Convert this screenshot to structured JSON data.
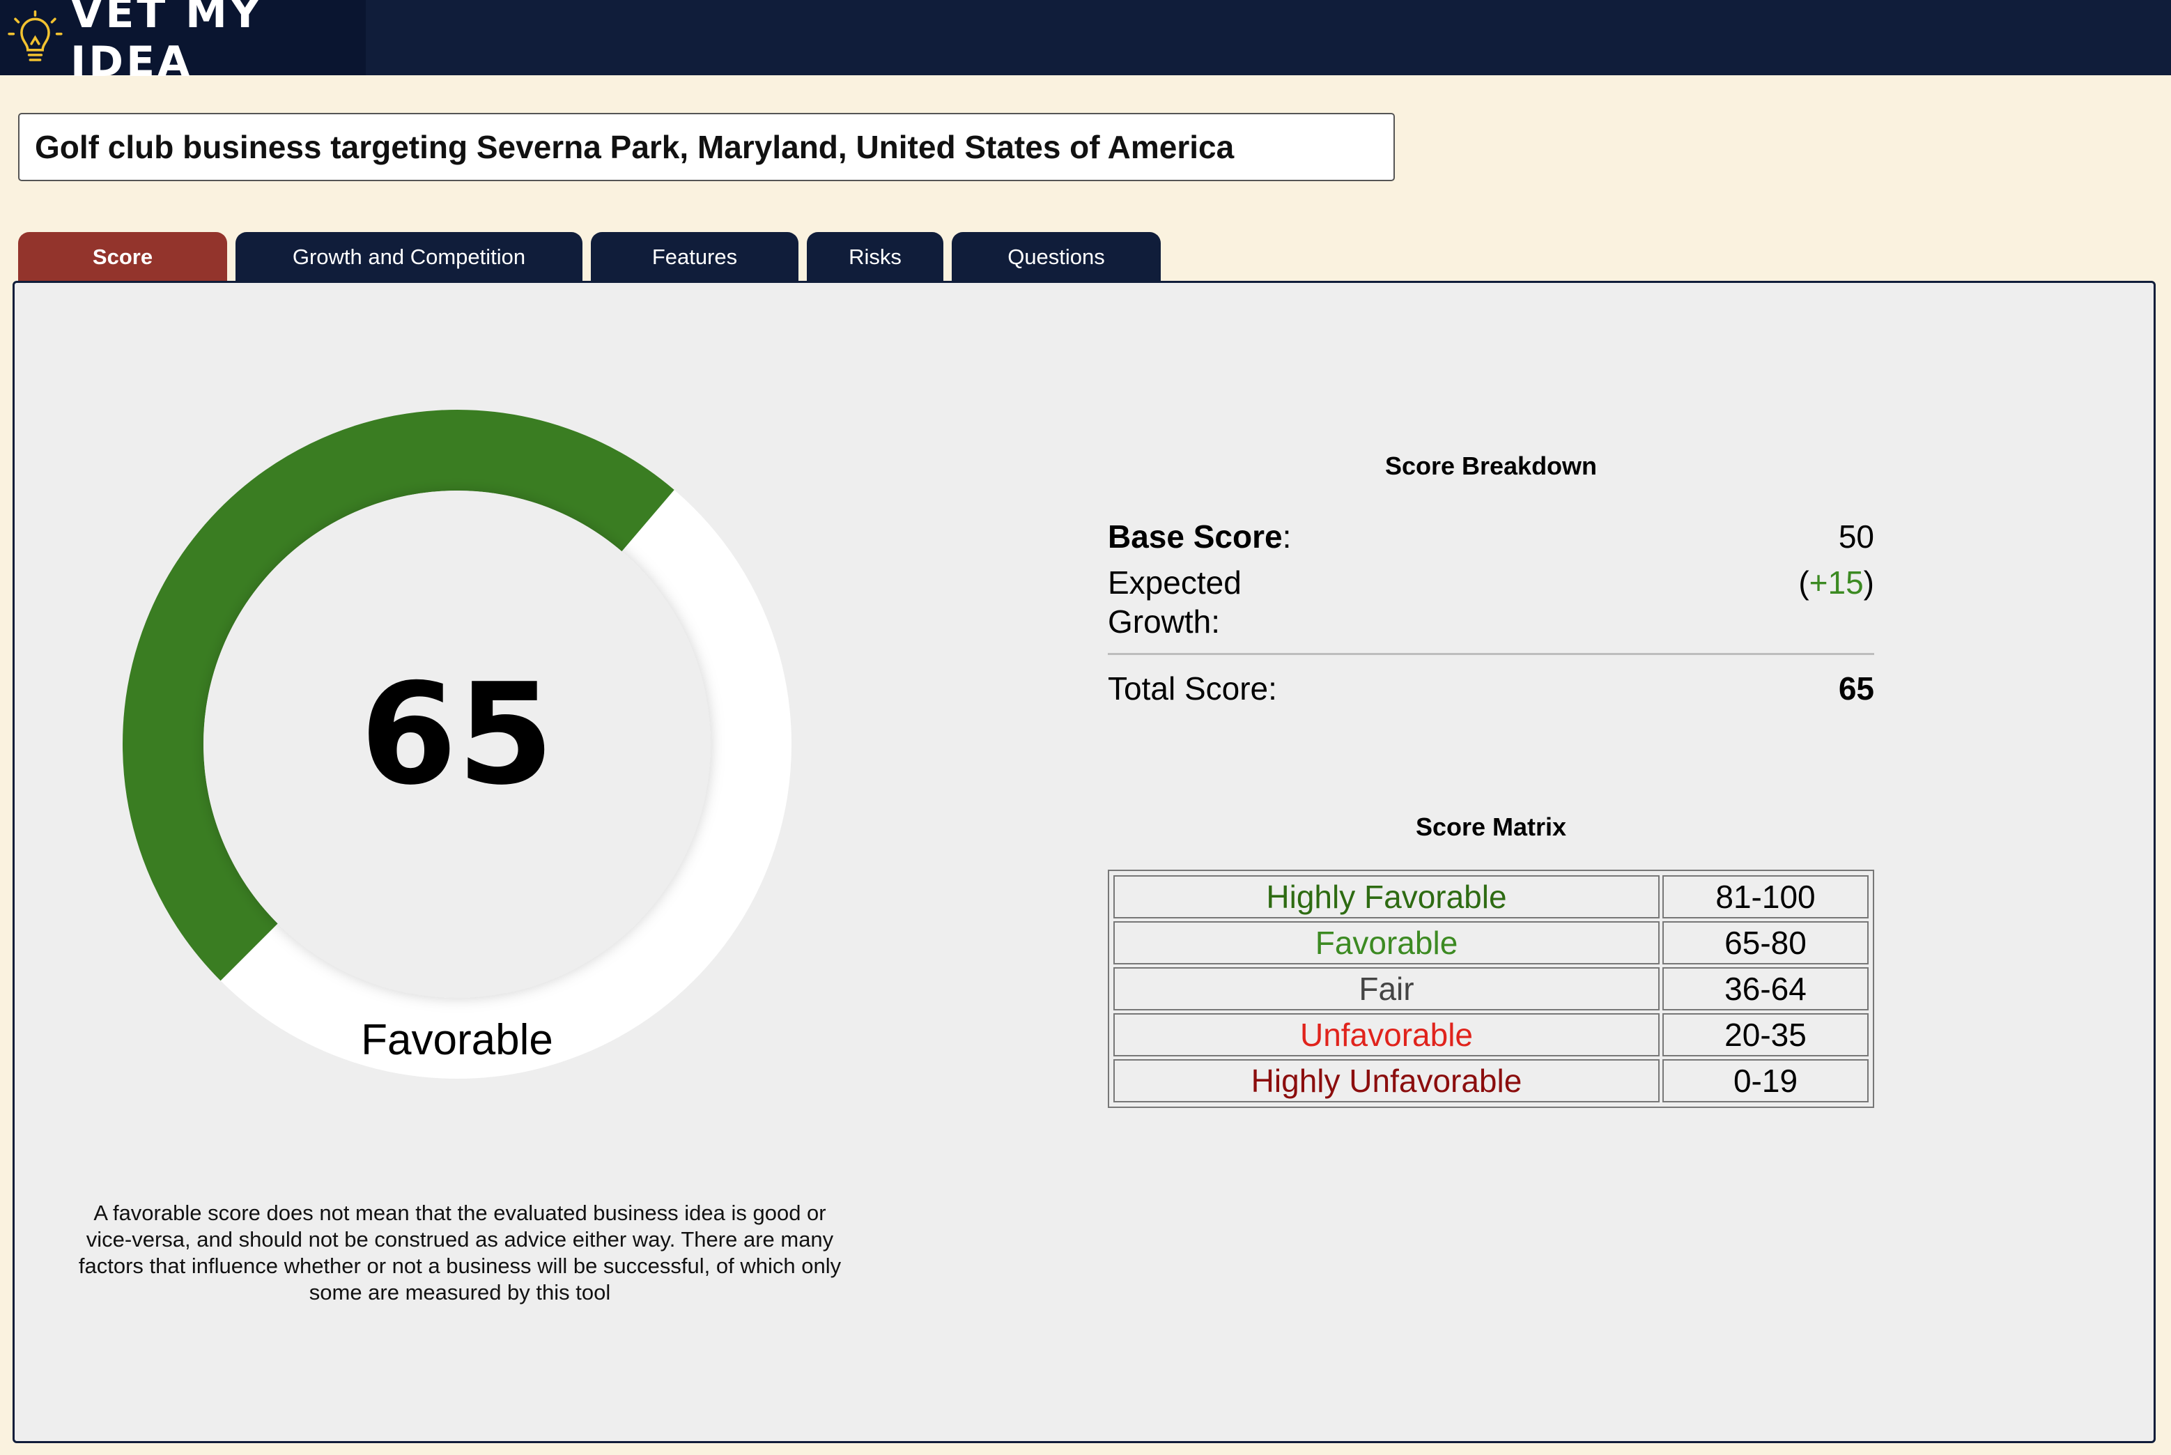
{
  "app": {
    "title": "VET MY IDEA",
    "logo_icon": "lightbulb-icon"
  },
  "idea": {
    "text": "Golf club business targeting Severna Park, Maryland, United States of America"
  },
  "tabs": [
    {
      "label": "Score",
      "active": true
    },
    {
      "label": "Growth and Competition",
      "active": false
    },
    {
      "label": "Features",
      "active": false
    },
    {
      "label": "Risks",
      "active": false
    },
    {
      "label": "Questions",
      "active": false
    }
  ],
  "gauge": {
    "score": "65",
    "score_fraction": 0.65,
    "rating": "Favorable",
    "fill_color": "#3a7d22"
  },
  "disclaimer": "A favorable score does not mean that the evaluated business idea is good or vice-versa, and should not be construed as advice either way. There are many factors that influence whether or not a business will be successful, of which only some are measured by this tool",
  "breakdown": {
    "title": "Score Breakdown",
    "base_label": "Base Score",
    "base_colon": ":",
    "base_value": "50",
    "growth_label_line1": "Expected",
    "growth_label_line2": "Growth:",
    "growth_paren_open": "(",
    "growth_value": "+15",
    "growth_paren_close": ")",
    "total_label": "Total Score:",
    "total_value": "65"
  },
  "matrix": {
    "title": "Score Matrix",
    "rows": [
      {
        "label": "Highly Favorable",
        "range": "81-100",
        "color": "#2e6b12"
      },
      {
        "label": "Favorable",
        "range": "65-80",
        "color": "#3c8a22"
      },
      {
        "label": "Fair",
        "range": "36-64",
        "color": "#444444"
      },
      {
        "label": "Unfavorable",
        "range": "20-35",
        "color": "#e0231c"
      },
      {
        "label": "Highly Unfavorable",
        "range": "0-19",
        "color": "#8b0d0d"
      }
    ]
  }
}
